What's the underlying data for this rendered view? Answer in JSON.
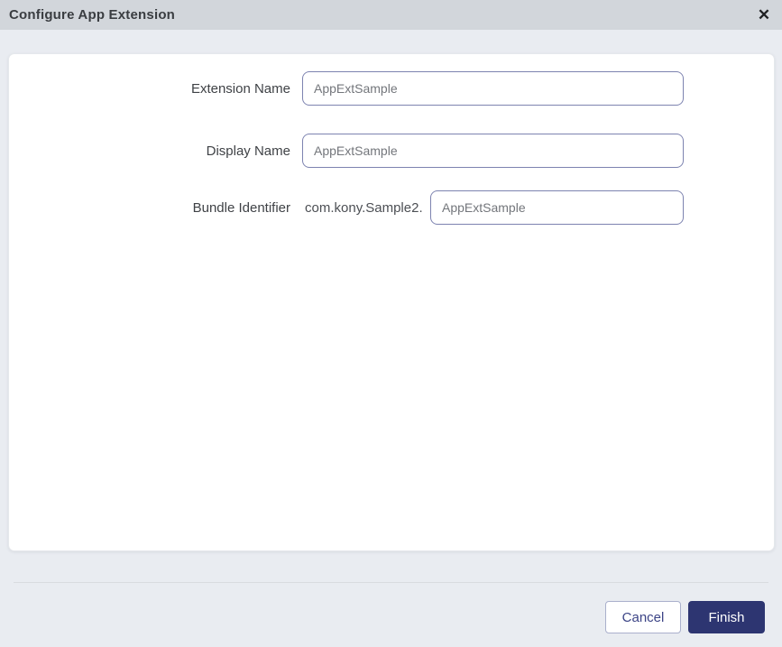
{
  "dialog": {
    "title": "Configure App Extension",
    "close_icon": "✕"
  },
  "form": {
    "fields": [
      {
        "label": "Extension Name",
        "value": "AppExtSample"
      },
      {
        "label": "Display Name",
        "value": "AppExtSample"
      },
      {
        "label": "Bundle Identifier",
        "prefix": "com.kony.Sample2.",
        "value": "AppExtSample"
      }
    ]
  },
  "footer": {
    "cancel_label": "Cancel",
    "finish_label": "Finish"
  },
  "colors": {
    "titlebar_bg": "#d2d6db",
    "body_bg": "#e9ecf1",
    "panel_bg": "#ffffff",
    "input_border": "#7d83b0",
    "accent_navy": "#2d3571",
    "cancel_text": "#3c4486",
    "divider": "#d8dbdf"
  }
}
